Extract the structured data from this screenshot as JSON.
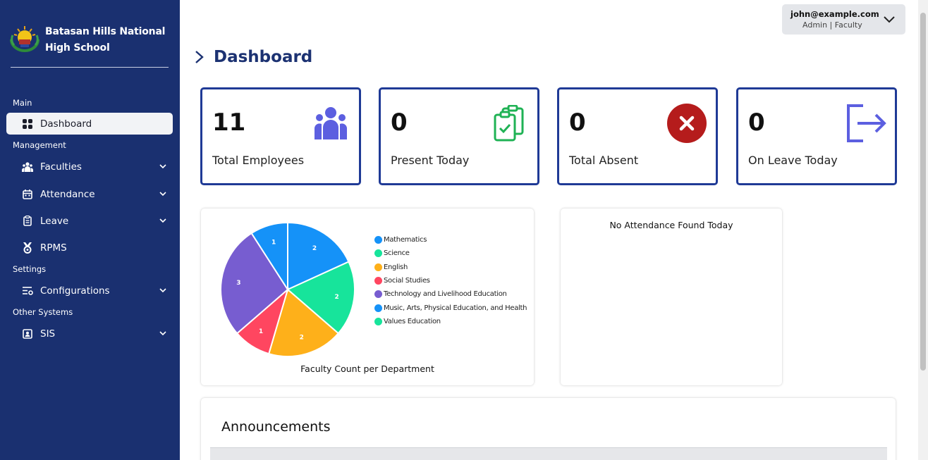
{
  "sidebar": {
    "brand": "Batasan Hills National High School",
    "brand_line1": "Batasan Hills National",
    "brand_line2": "High School",
    "sections": [
      {
        "label": "Main"
      },
      {
        "label": "Management"
      },
      {
        "label": "Settings"
      },
      {
        "label": "Other Systems"
      }
    ],
    "items": [
      {
        "label": "Dashboard",
        "icon": "grid-icon",
        "active": true
      },
      {
        "label": "Faculties",
        "icon": "users-icon"
      },
      {
        "label": "Attendance",
        "icon": "calendar-icon"
      },
      {
        "label": "Leave",
        "icon": "clipboard-icon"
      },
      {
        "label": "RPMS",
        "icon": "medal-icon"
      },
      {
        "label": "Configurations",
        "icon": "sliders-icon"
      },
      {
        "label": "SIS",
        "icon": "id-card-icon"
      }
    ]
  },
  "user": {
    "email": "john@example.com",
    "role": "Admin | Faculty"
  },
  "page": {
    "title": "Dashboard"
  },
  "stats": [
    {
      "value": "11",
      "label": "Total Employees",
      "icon": "users-icon",
      "color": "#5c5fe0"
    },
    {
      "value": "0",
      "label": "Present Today",
      "icon": "clipboard-check-icon",
      "color": "#1fb254"
    },
    {
      "value": "0",
      "label": "Total Absent",
      "icon": "x-circle-icon",
      "color": "#b51c1c"
    },
    {
      "value": "0",
      "label": "On Leave Today",
      "icon": "exit-icon",
      "color": "#5c5fe0"
    }
  ],
  "chart_data": {
    "type": "pie",
    "title": "Faculty Count per Department",
    "categories": [
      "Mathematics",
      "Science",
      "English",
      "Social Studies",
      "Technology and Livelihood Education",
      "Music, Arts, Physical Education, and Health",
      "Values Education"
    ],
    "values": [
      2,
      2,
      2,
      1,
      3,
      1,
      0
    ],
    "colors": [
      "#1592f8",
      "#17e49b",
      "#feb01a",
      "#ff4660",
      "#775dd0",
      "#1592f8",
      "#17e49b"
    ],
    "legend_position": "right"
  },
  "attendance": {
    "empty_text": "No Attendance Found Today"
  },
  "announcements": {
    "title": "Announcements"
  }
}
